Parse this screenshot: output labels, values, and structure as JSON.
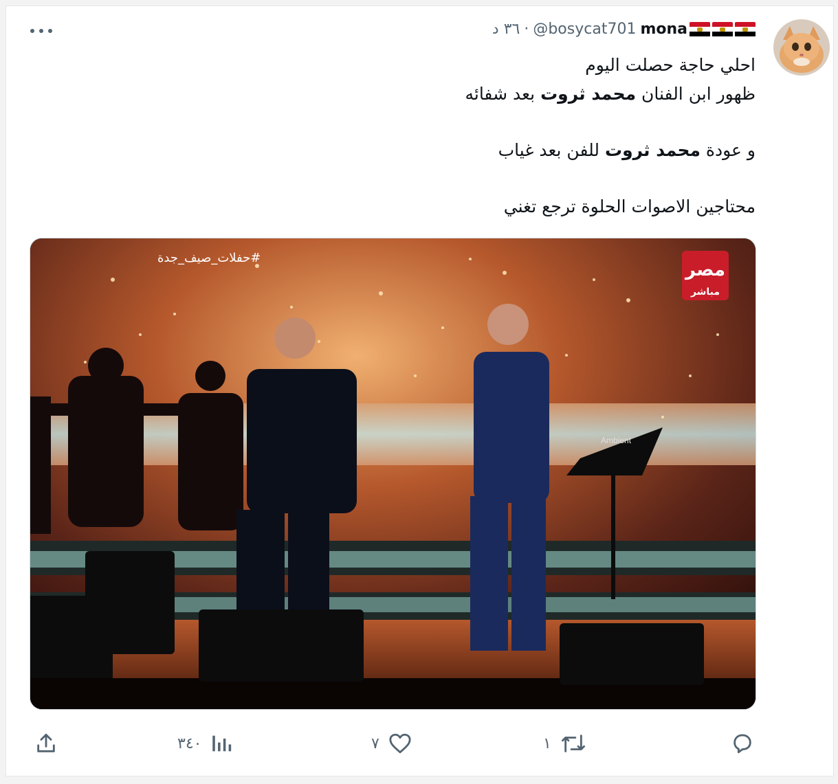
{
  "tweet": {
    "display_name": "mona",
    "name_flags": [
      "egypt-flag",
      "egypt-flag",
      "egypt-flag"
    ],
    "handle": "@bosycat701",
    "separator": "·",
    "time": "٣٦ د",
    "lines": [
      "احلي حاجة حصلت اليوم",
      [
        "ظهور ابن الفنان ",
        "محمد ثروت",
        " بعد شفائه"
      ],
      [
        "و عودة ",
        "محمد ثروت",
        " للفن بعد غياب"
      ],
      "محتاجين الاصوات الحلوة ترجع تغني"
    ],
    "media": {
      "hashtag_overlay": "#حفلات_صيف_جدة",
      "channel_logo_top": "مصر",
      "channel_logo_bottom": "مباشر",
      "stand_label": "Ambient"
    }
  },
  "actions": {
    "reply_icon": "reply-icon",
    "reply_count": "",
    "retweet_icon": "retweet-icon",
    "retweet_count": "١",
    "like_icon": "heart-icon",
    "like_count": "٧",
    "views_icon": "analytics-icon",
    "views_count": "٣٤٠",
    "share_icon": "share-icon"
  },
  "colors": {
    "text": "#0f1419",
    "secondary": "#536471",
    "flag_red": "#ce1126",
    "flag_black": "#000000",
    "stage_glow": "#c8743a"
  }
}
